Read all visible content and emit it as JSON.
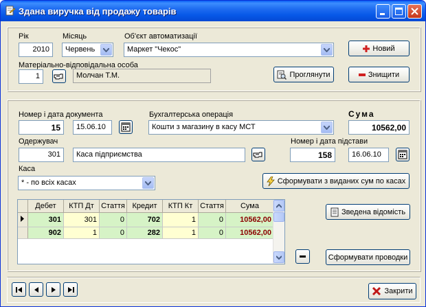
{
  "window": {
    "title": "Здана виручка від продажу товарів"
  },
  "header": {
    "year_label": "Рік",
    "year_value": "2010",
    "month_label": "Місяць",
    "month_value": "Червень",
    "object_label": "Об'єкт автоматизації",
    "object_value": "Маркет \"Чекос\"",
    "person_label": "Матеріально-відповідальна особа",
    "person_code": "1",
    "person_name": "Молчан Т.М.",
    "new_label": "Новий",
    "view_label": "Проглянути",
    "delete_label": "Знищити"
  },
  "document": {
    "number_label": "Номер і дата документа",
    "number_value": "15",
    "date_value": "15.06.10",
    "operation_label": "Бухгалтерська операція",
    "operation_value": "Кошти з магазину в касу МСТ",
    "sum_label": "Сума",
    "sum_value": "10562,00",
    "recipient_label": "Одержувач",
    "recipient_code": "301",
    "recipient_name": "Каса підприємства",
    "basis_label": "Номер і дата підстави",
    "basis_number": "158",
    "basis_date": "16.06.10",
    "cash_label": "Каса",
    "cash_value": "* - по всіх касах",
    "generate_label": "Сформувати з виданих сум по касах"
  },
  "grid": {
    "columns": [
      "Дебет",
      "КТП Дт",
      "Стаття",
      "Кредит",
      "КТП Кт",
      "Стаття",
      "Сума"
    ],
    "rows": [
      [
        "301",
        "301",
        "0",
        "702",
        "1",
        "0",
        "10562,00"
      ],
      [
        "902",
        "1",
        "0",
        "282",
        "1",
        "0",
        "10562,00"
      ]
    ]
  },
  "actions": {
    "summary_label": "Зведена відомість",
    "postings_label": "Сформувати проводки",
    "close_label": "Закрити"
  },
  "colors": {
    "title_bar": "#0758e8",
    "debit_cell": "#d6f3c6",
    "ktp_cell": "#ffffd2",
    "sum_text": "#8b0000"
  }
}
